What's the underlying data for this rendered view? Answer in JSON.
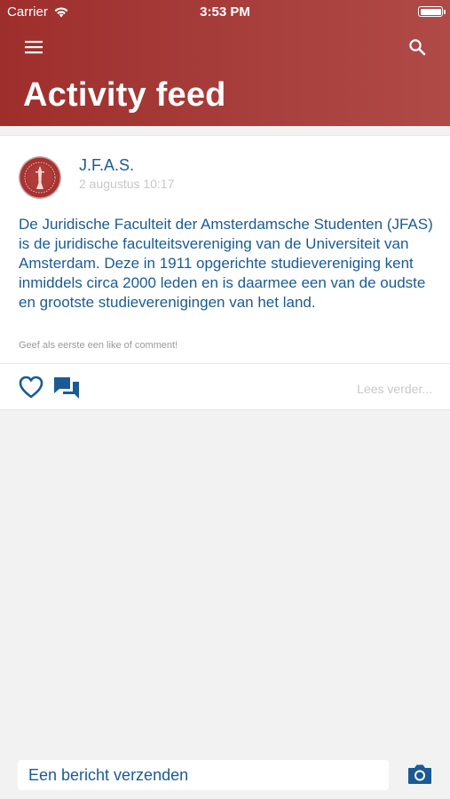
{
  "status_bar": {
    "carrier": "Carrier",
    "time": "3:53 PM",
    "icons": [
      "wifi-icon",
      "battery-icon"
    ]
  },
  "header": {
    "title": "Activity feed",
    "menu_icon": "hamburger-menu-icon",
    "search_icon": "search-icon",
    "background_color": "#a03a38",
    "text_color": "#ffffff"
  },
  "feed": {
    "posts": [
      {
        "author": "J.F.A.S.",
        "date": "2 augustus 10:17",
        "avatar_icon": "seal-logo-avatar",
        "body": "De Juridische Faculteit der Amsterdamsche Studenten (JFAS) is de juridische faculteitsvereniging van de Universiteit van Amsterdam. Deze in 1911 opgerichte studievereniging kent inmiddels circa 2000 leden en is daarmee een van de oudste en grootste studieverenigingen van het land.",
        "engagement_hint": "Geef als eerste een like of comment!",
        "like_icon": "heart-outline-icon",
        "comment_icon": "chat-bubbles-icon",
        "read_more": "Lees verder..."
      }
    ]
  },
  "composer": {
    "placeholder": "Een bericht verzenden",
    "camera_icon": "camera-icon"
  },
  "colors": {
    "primary_blue": "#1a5b93",
    "muted_text": "#c8c8c8",
    "page_background": "#f2f2f2"
  }
}
